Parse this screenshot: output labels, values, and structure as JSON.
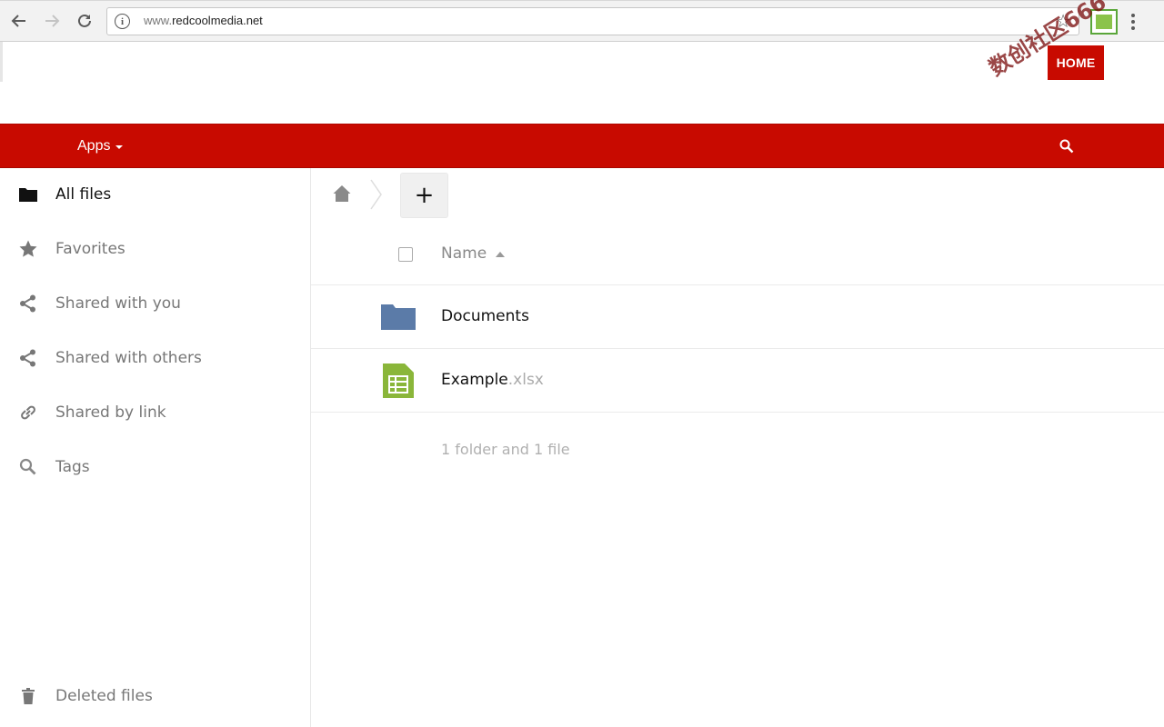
{
  "browser": {
    "url_host_prefix": "www.",
    "url_host": "redcoolmedia.net",
    "back_icon": "arrow-left-icon",
    "forward_icon": "arrow-right-icon",
    "reload_icon": "reload-icon",
    "bookmark_icon": "star-outline-icon"
  },
  "site": {
    "home_button": "HOME",
    "watermark": "数创社区666"
  },
  "header": {
    "apps_label": "Apps",
    "search_icon": "search-icon",
    "accent_color": "#c80a00"
  },
  "sidebar": {
    "items": [
      {
        "label": "All files",
        "icon": "folder-icon",
        "active": true
      },
      {
        "label": "Favorites",
        "icon": "star-icon"
      },
      {
        "label": "Shared with you",
        "icon": "share-icon"
      },
      {
        "label": "Shared with others",
        "icon": "share-icon"
      },
      {
        "label": "Shared by link",
        "icon": "link-icon"
      },
      {
        "label": "Tags",
        "icon": "search-icon"
      }
    ],
    "deleted": {
      "label": "Deleted files",
      "icon": "trash-icon"
    }
  },
  "files": {
    "new_button": "+",
    "column_name": "Name",
    "rows": [
      {
        "name": "Documents",
        "ext": "",
        "type": "folder",
        "color": "#5b7ba8"
      },
      {
        "name": "Example",
        "ext": ".xlsx",
        "type": "spreadsheet",
        "color": "#8ab63a"
      }
    ],
    "summary": "1 folder and 1 file"
  }
}
